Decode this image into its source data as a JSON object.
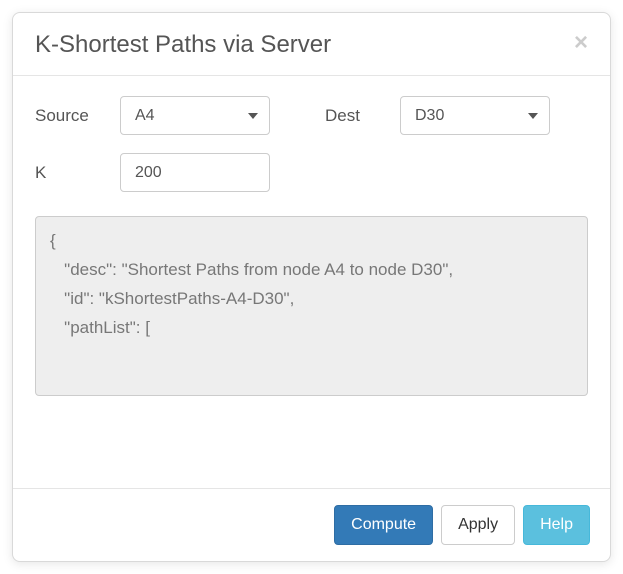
{
  "title": "K-Shortest Paths via Server",
  "labels": {
    "source": "Source",
    "dest": "Dest",
    "k": "K"
  },
  "form": {
    "source_value": "A4",
    "dest_value": "D30",
    "k_value": "200"
  },
  "output": "{\n   \"desc\": \"Shortest Paths from node A4 to node D30\",\n   \"id\": \"kShortestPaths-A4-D30\",\n   \"pathList\": [",
  "buttons": {
    "compute": "Compute",
    "apply": "Apply",
    "help": "Help"
  }
}
